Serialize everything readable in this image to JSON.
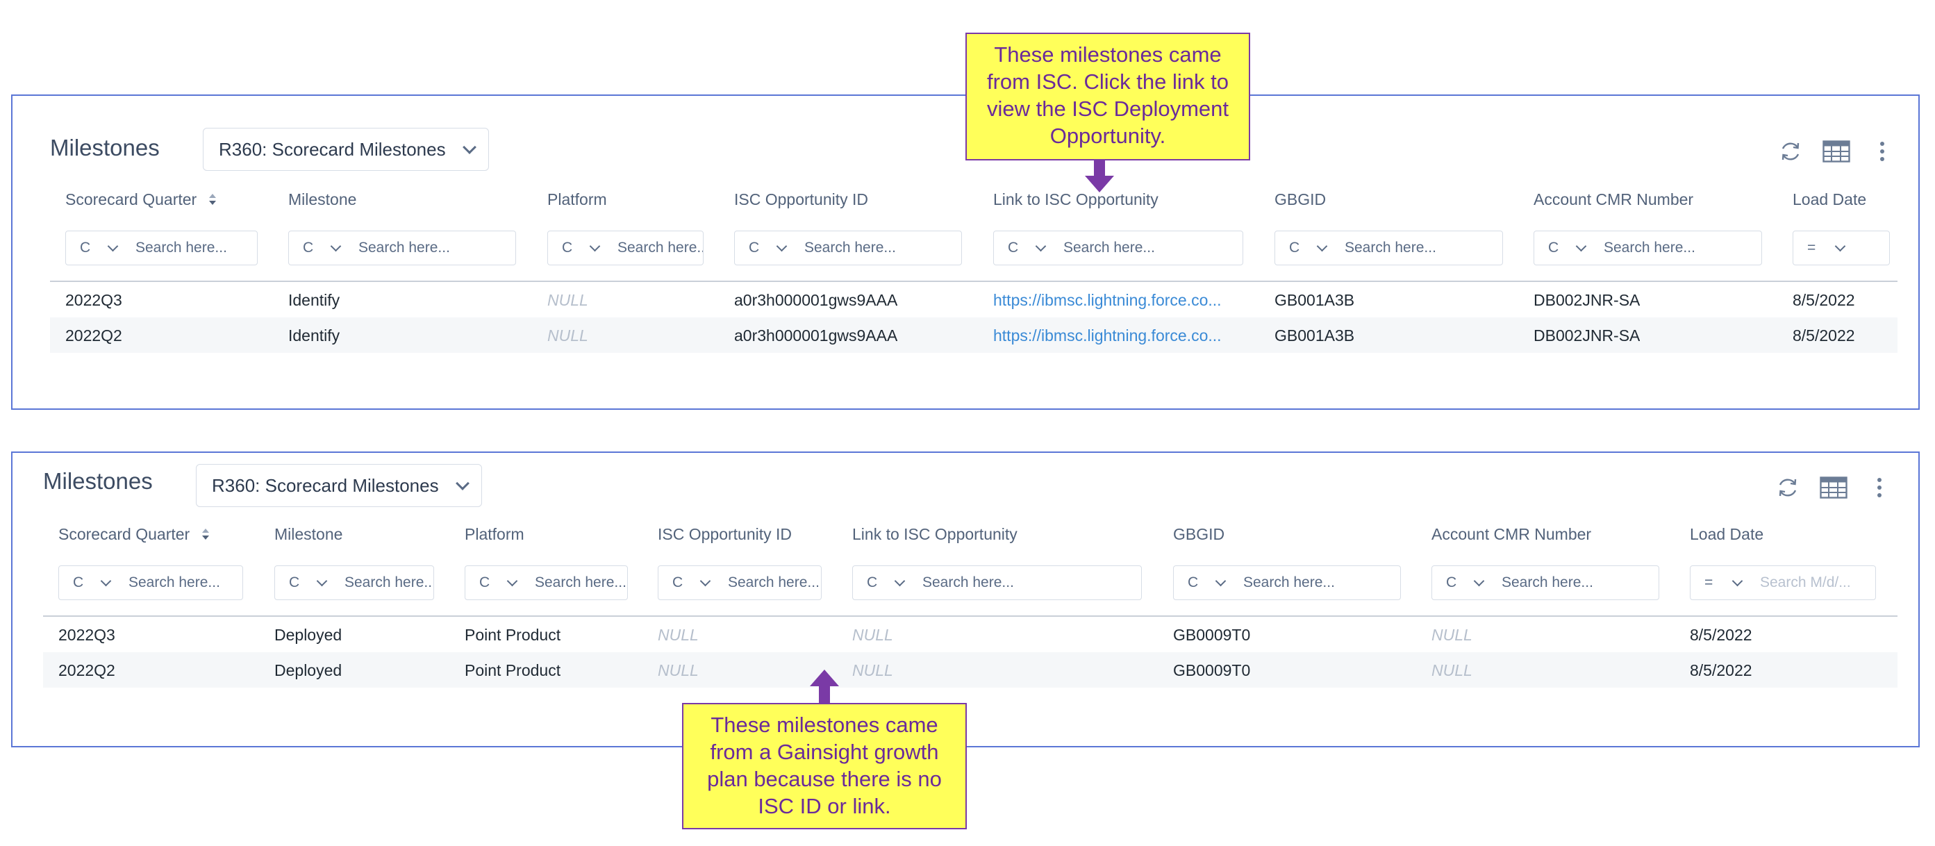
{
  "panels": [
    {
      "title": "Milestones",
      "view_select": "R360: Scorecard Milestones",
      "columns": [
        {
          "label": "Scorecard Quarter",
          "sortable": true
        },
        {
          "label": "Milestone"
        },
        {
          "label": "Platform"
        },
        {
          "label": "ISC Opportunity ID"
        },
        {
          "label": "Link to ISC Opportunity"
        },
        {
          "label": "GBGID"
        },
        {
          "label": "Account CMR Number"
        },
        {
          "label": "Load Date"
        }
      ],
      "filters": [
        {
          "op": "C",
          "placeholder": "Search here..."
        },
        {
          "op": "C",
          "placeholder": "Search here..."
        },
        {
          "op": "C",
          "placeholder": "Search here..."
        },
        {
          "op": "C",
          "placeholder": "Search here..."
        },
        {
          "op": "C",
          "placeholder": "Search here..."
        },
        {
          "op": "C",
          "placeholder": "Search here..."
        },
        {
          "op": "C",
          "placeholder": "Search here..."
        },
        {
          "op": "=",
          "placeholder": ""
        }
      ],
      "rows": [
        [
          "2022Q3",
          "Identify",
          "NULL",
          "a0r3h000001gws9AAA",
          "https://ibmsc.lightning.force.co...",
          "GB001A3B",
          "DB002JNR-SA",
          "8/5/2022"
        ],
        [
          "2022Q2",
          "Identify",
          "NULL",
          "a0r3h000001gws9AAA",
          "https://ibmsc.lightning.force.co...",
          "GB001A3B",
          "DB002JNR-SA",
          "8/5/2022"
        ]
      ]
    },
    {
      "title": "Milestones",
      "view_select": "R360: Scorecard Milestones",
      "columns": [
        {
          "label": "Scorecard Quarter",
          "sortable": true
        },
        {
          "label": "Milestone"
        },
        {
          "label": "Platform"
        },
        {
          "label": "ISC Opportunity ID"
        },
        {
          "label": "Link to ISC Opportunity"
        },
        {
          "label": "GBGID"
        },
        {
          "label": "Account CMR Number"
        },
        {
          "label": "Load Date"
        }
      ],
      "filters": [
        {
          "op": "C",
          "placeholder": "Search here..."
        },
        {
          "op": "C",
          "placeholder": "Search here..."
        },
        {
          "op": "C",
          "placeholder": "Search here..."
        },
        {
          "op": "C",
          "placeholder": "Search here..."
        },
        {
          "op": "C",
          "placeholder": "Search here..."
        },
        {
          "op": "C",
          "placeholder": "Search here..."
        },
        {
          "op": "C",
          "placeholder": "Search here..."
        },
        {
          "op": "=",
          "placeholder": "Search M/d/..."
        }
      ],
      "rows": [
        [
          "2022Q3",
          "Deployed",
          "Point Product",
          "NULL",
          "NULL",
          "GB0009T0",
          "NULL",
          "8/5/2022"
        ],
        [
          "2022Q2",
          "Deployed",
          "Point Product",
          "NULL",
          "NULL",
          "GB0009T0",
          "NULL",
          "8/5/2022"
        ]
      ]
    }
  ],
  "callouts": {
    "top": "These milestones came from ISC. Click the link to view the ISC Deployment Opportunity.",
    "bottom": "These milestones came from a Gainsight growth plan because there is no ISC ID or link."
  },
  "icons": {
    "refresh": "refresh-icon",
    "table": "table-view-icon",
    "more": "more-options-icon",
    "sort": "sort-icon",
    "dropdown": "chevron-down-icon"
  },
  "colors": {
    "panel_border": "#5b76d6",
    "callout_bg": "#ffff5a",
    "callout_text": "#6a2a9a",
    "link": "#3a8ad6",
    "null_text": "#b6bfcc"
  }
}
